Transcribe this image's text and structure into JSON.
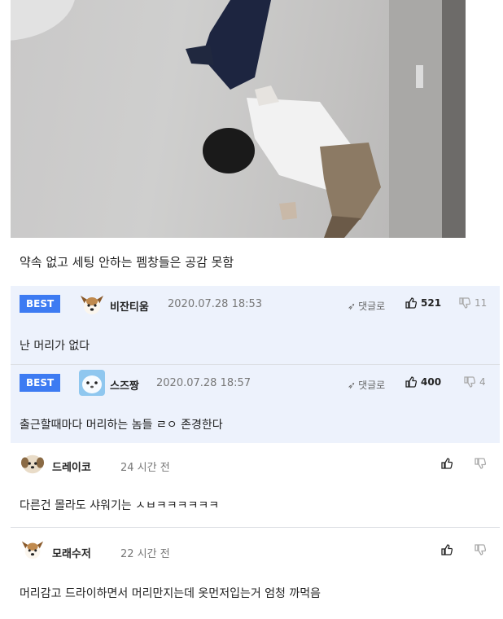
{
  "post": {
    "caption": "약속 없고 세팅 안하는 펨창들은 공감 못함"
  },
  "comments": [
    {
      "best": true,
      "badge": "BEST",
      "author": "비잔티움",
      "time": "2020.07.28 18:53",
      "reply_label": "댓글로",
      "likes": "521",
      "dislikes": "11",
      "text": "난 머리가 없다"
    },
    {
      "best": true,
      "badge": "BEST",
      "author": "스즈짱",
      "time": "2020.07.28 18:57",
      "reply_label": "댓글로",
      "likes": "400",
      "dislikes": "4",
      "text": "출근할때마다 머리하는 놈들 ㄹㅇ 존경한다"
    },
    {
      "best": false,
      "author": "드레이코",
      "time": "24 시간 전",
      "text": "다른건 몰라도 샤워기는 ㅅㅂㅋㅋㅋㅋㅋㅋ"
    },
    {
      "best": false,
      "author": "모래수저",
      "time": "22 시간 전",
      "text": "머리감고 드라이하면서 머리만지는데 옷먼저입는거 엄청 까먹음"
    }
  ],
  "colors": {
    "best_badge": "#3d7bf2",
    "best_background": "#edf2fc"
  }
}
